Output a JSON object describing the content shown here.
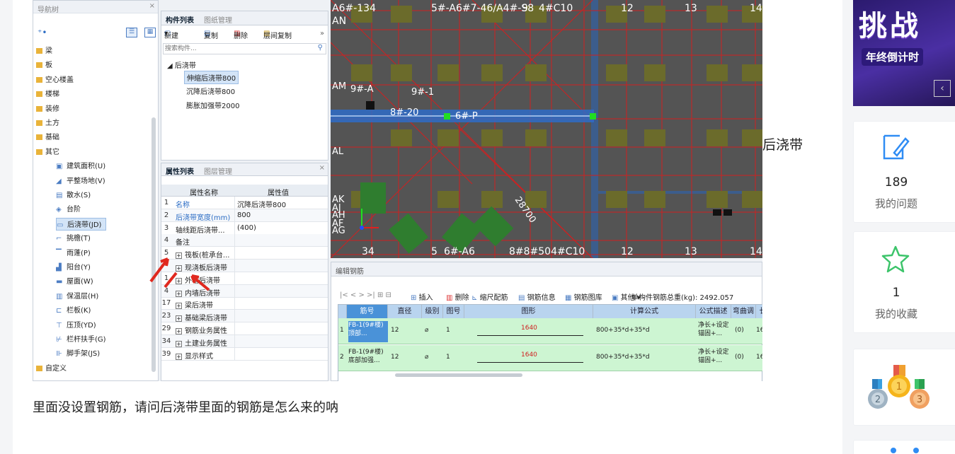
{
  "nav_panel": {
    "title": "导航树"
  },
  "nav_tree": {
    "groups": [
      "梁",
      "板",
      "空心楼盖",
      "楼梯",
      "装修",
      "土方",
      "基础",
      "其它"
    ],
    "sub_items": [
      "建筑面积(U)",
      "平整场地(V)",
      "散水(S)",
      "台阶",
      "后浇带(JD)",
      "挑檐(T)",
      "雨蓬(P)",
      "阳台(Y)",
      "屋面(W)",
      "保温层(H)",
      "栏板(K)",
      "压顶(YD)",
      "栏杆扶手(G)",
      "脚手架(JS)"
    ],
    "last_group": "自定义",
    "selected": "后浇带(JD)"
  },
  "component_panel": {
    "tab_active": "构件列表",
    "tab_inactive": "图纸管理",
    "toolbar": {
      "new": "新建",
      "copy": "复制",
      "delete": "删除",
      "floor_copy": "层间复制"
    },
    "search_placeholder": "搜索构件...",
    "root": "后浇带",
    "items": [
      "伸缩后浇带800",
      "沉降后浇带800",
      "膨胀加强带2000"
    ],
    "selected": "伸缩后浇带800"
  },
  "property_panel": {
    "tab_active": "属性列表",
    "tab_inactive": "图层管理",
    "col_name": "属性名称",
    "col_value": "属性值",
    "rows": [
      {
        "n": "1",
        "name": "名称",
        "value": "沉降后浇带800",
        "blue": true
      },
      {
        "n": "2",
        "name": "后浇带宽度(mm)",
        "value": "800",
        "blue": true
      },
      {
        "n": "3",
        "name": "轴线距后浇带...",
        "value": "(400)",
        "blue": false
      },
      {
        "n": "4",
        "name": "备注",
        "value": "",
        "blue": false
      },
      {
        "n": "5",
        "name": "筏板(桩承台...",
        "value": "",
        "blue": false,
        "exp": true
      },
      {
        "n": "",
        "name": "现浇板后浇带",
        "value": "",
        "blue": false,
        "exp": true
      },
      {
        "n": "1",
        "name": "外墙后浇带",
        "value": "",
        "blue": false,
        "exp": true
      },
      {
        "n": "4",
        "name": "内墙后浇带",
        "value": "",
        "blue": false,
        "exp": true
      },
      {
        "n": "17",
        "name": "梁后浇带",
        "value": "",
        "blue": false,
        "exp": true
      },
      {
        "n": "23",
        "name": "基础梁后浇带",
        "value": "",
        "blue": false,
        "exp": true
      },
      {
        "n": "29",
        "name": "钢筋业务属性",
        "value": "",
        "blue": false,
        "exp": true
      },
      {
        "n": "34",
        "name": "土建业务属性",
        "value": "",
        "blue": false,
        "exp": true
      },
      {
        "n": "39",
        "name": "显示样式",
        "value": "",
        "blue": false,
        "exp": true
      }
    ]
  },
  "cad": {
    "top_labels": [
      "A6#-134",
      "AN",
      "5#-A6#7-46/A4#-S8",
      "9",
      "4#C10",
      "12",
      "13",
      "14"
    ],
    "bottom_labels": [
      "34",
      "5",
      "6#-A6",
      "8#8#504#C10",
      "12",
      "13",
      "14"
    ],
    "side_labels": [
      "AM",
      "AL",
      "AK",
      "AJ",
      "AH",
      "AF",
      "AG"
    ],
    "mid_labels": [
      "9#-A",
      "9#-1",
      "8#-20",
      "6#-P",
      "28700"
    ]
  },
  "rebar_panel": {
    "title": "编辑钢筋",
    "toolbar": [
      "插入",
      "删除",
      "缩尺配筋",
      "钢筋信息",
      "钢筋图库",
      "其他",
      "单构件钢筋总重(kg): 2492.057"
    ],
    "headers": [
      "筋号",
      "直径(mm)",
      "级别",
      "图号",
      "图形",
      "计算公式",
      "公式描述",
      "弯曲调整",
      "长"
    ],
    "rows": [
      {
        "n": "1",
        "name": "FB-1(9#楼) 顶部...",
        "dia": "12",
        "grade": "⌀",
        "fig": "1",
        "len": "1640",
        "formula": "800+35*d+35*d",
        "desc": "净长+设定锚固+...",
        "adj": "(0)",
        "long": "16"
      },
      {
        "n": "2",
        "name": "FB-1(9#楼) 底部加强...",
        "dia": "12",
        "grade": "⌀",
        "fig": "1",
        "len": "1640",
        "formula": "800+35*d+35*d",
        "desc": "净长+设定锚固+...",
        "adj": "(0)",
        "long": "16"
      }
    ]
  },
  "outer_label": "后浇带",
  "caption": "里面没设置钢筋，请问后浇带里面的钢筋是怎么来的呐",
  "sidebar": {
    "banner_title": "挑战",
    "banner_subtitle": "年终倒计时",
    "stats": [
      {
        "count": "189",
        "label": "我的问题",
        "icon": "edit-icon"
      },
      {
        "count": "1",
        "label": "我的收藏",
        "icon": "star-icon"
      }
    ]
  },
  "colors": {
    "accent": "#1a8cff",
    "cad_bg": "#545454",
    "column": "#6b6b2b",
    "grid_red": "#d02020"
  }
}
